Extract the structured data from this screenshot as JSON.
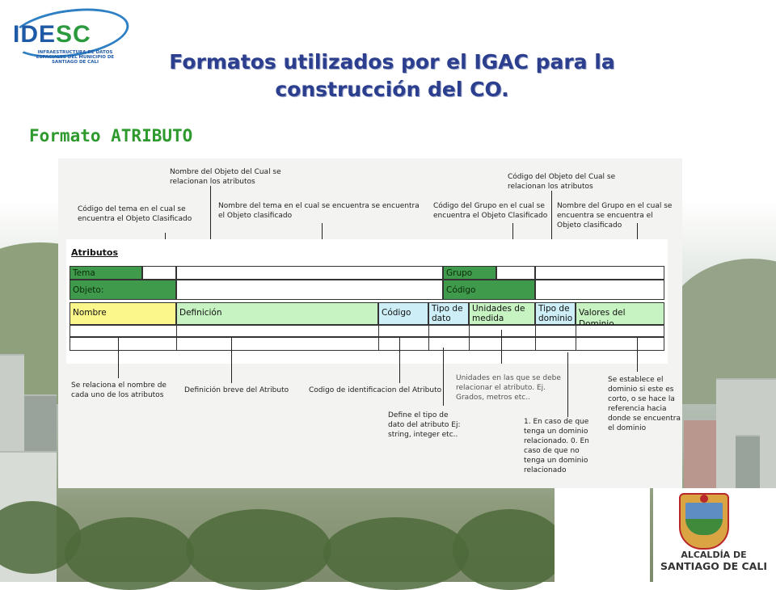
{
  "logo": {
    "name_part1": "IDE",
    "name_part2": "SC",
    "subtitle": "INFRAESTRUCTURA DE DATOS ESPACIALES DEL MUNICIPIO DE SANTIAGO DE CALI"
  },
  "slide": {
    "title_line1": "Formatos utilizados por el IGAC para la",
    "title_line2": "construcción del CO.",
    "subtitle": "Formato ATRIBUTO"
  },
  "figure": {
    "top_notes": {
      "nombre_objeto": "Nombre del Objeto del Cual se relacionan los atributos",
      "codigo_tema": "Código del tema en el cual se encuentra el Objeto Clasificado",
      "nombre_tema": "Nombre del tema en el cual se encuentra se encuentra el Objeto clasificado",
      "codigo_grupo": "Código del Grupo en el cual se encuentra el Objeto Clasificado",
      "codigo_objeto": "Código del Objeto del Cual se relacionan los atributos",
      "nombre_grupo": "Nombre del Grupo en el cual se encuentra se encuentra el Objeto clasificado"
    },
    "form": {
      "title": "Atributos",
      "tema": "Tema",
      "grupo": "Grupo",
      "objeto": "Objeto:",
      "codigo": "Código",
      "columns": {
        "nombre": "Nombre",
        "definicion": "Definición",
        "codigo": "Código",
        "tipo_dato_1": "Tipo de",
        "tipo_dato_2": "dato",
        "unidades_1": "Unidades de",
        "unidades_2": "medida",
        "tipo_dominio_1": "Tipo de",
        "tipo_dominio_2": "dominio",
        "valores_dominio": "Valores del Dominio"
      }
    },
    "bottom_notes": {
      "nombre": "Se relaciona el nombre de cada uno de los atributos",
      "definicion": "Definición breve del Atributo",
      "codigo": "Codigo de identificacion del Atributo",
      "tipo_dato": "Define el tipo de dato del atributo Ej: string, integer etc..",
      "unidades": "Unidades en las que se debe relacionar el atributo. Ej. Grados, metros etc..",
      "tipo_dominio": "1. En caso de que tenga un dominio relacionado. 0. En caso de que no tenga un dominio relacionado",
      "valores_dominio": "Se establece el dominio si este es corto, o se hace la referencia hacia donde se encuentra el dominio"
    }
  },
  "seal": {
    "line1": "ALCALDÍA DE",
    "line2": "SANTIAGO DE CALI"
  },
  "colors": {
    "title": "#2b3f8e",
    "subtitle": "#2e9a2e",
    "dark_green_cell": "#3f9b4b",
    "yellow_cell": "#fbf78a",
    "light_green_cell": "#c7f2c2",
    "light_blue_cell": "#cdeef6"
  }
}
